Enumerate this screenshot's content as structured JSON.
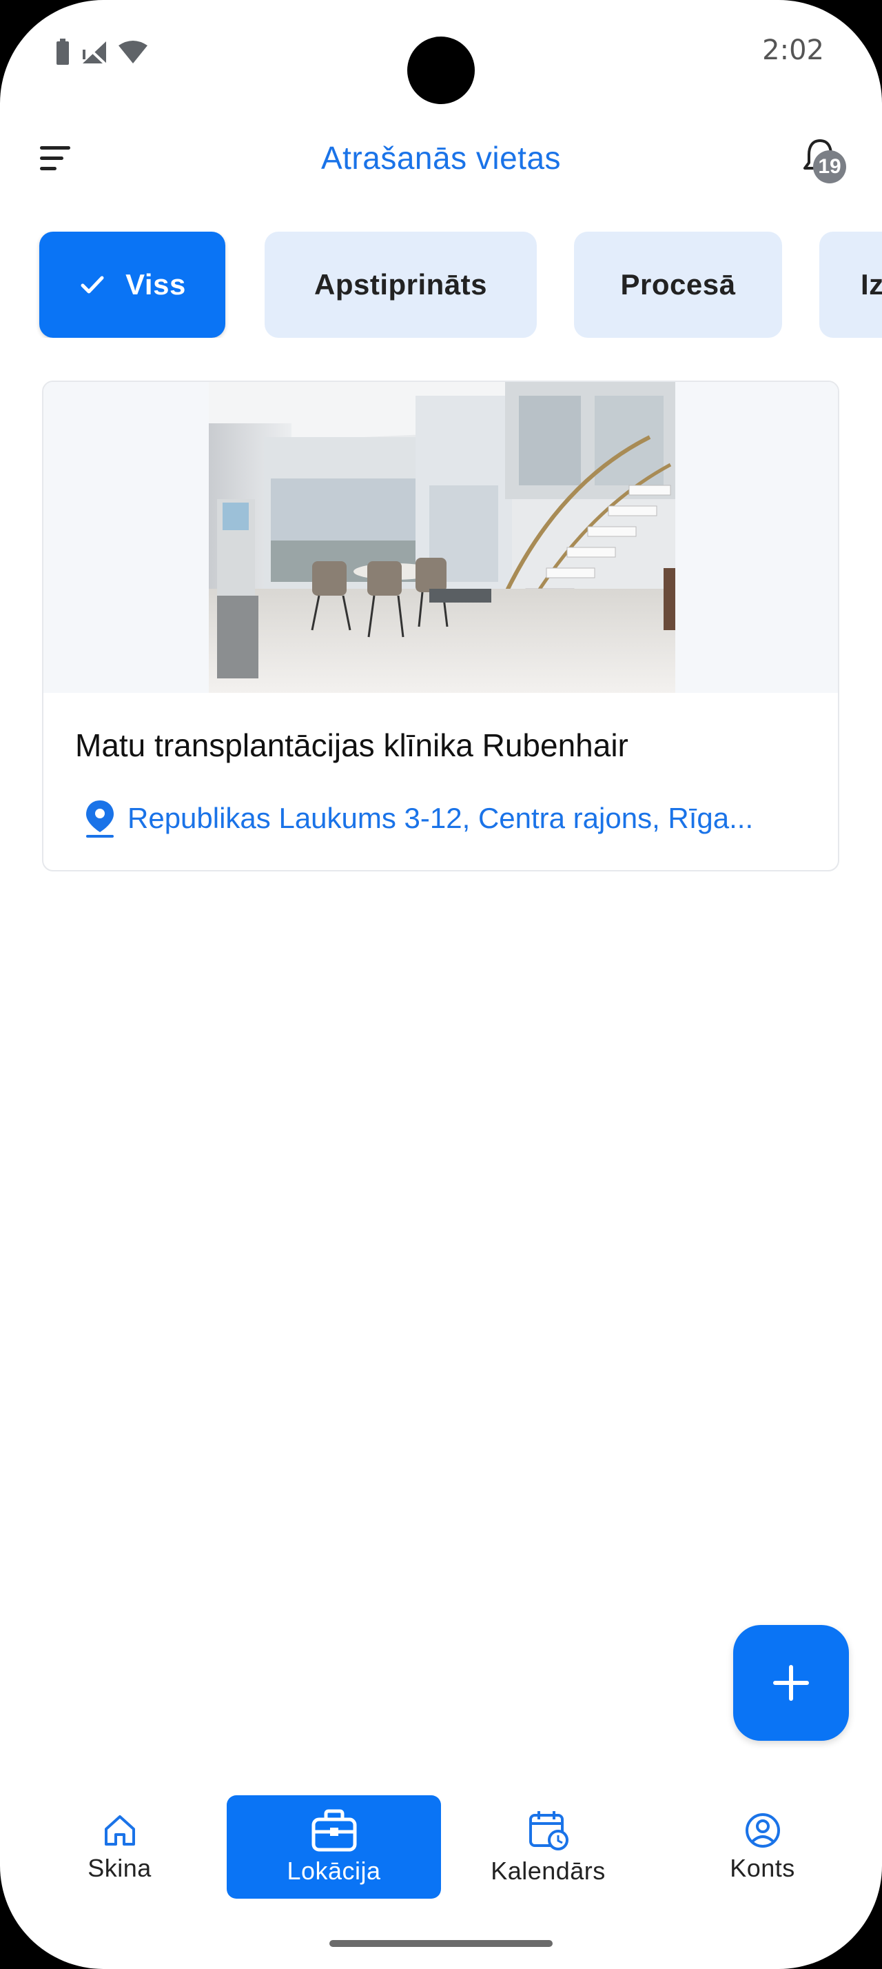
{
  "status_bar": {
    "time": "2:02"
  },
  "header": {
    "title": "Atrašanās vietas",
    "notification_count": "19"
  },
  "filters": [
    {
      "label": "Viss",
      "selected": true
    },
    {
      "label": "Apstiprināts",
      "selected": false
    },
    {
      "label": "Procesā",
      "selected": false
    },
    {
      "label": "Iz",
      "selected": false
    }
  ],
  "locations": [
    {
      "name": "Matu transplantācijas klīnika Rubenhair",
      "address": "Republikas Laukums 3-12, Centra rajons, Rīga..."
    }
  ],
  "fab": {
    "icon": "plus-icon"
  },
  "bottom_nav": [
    {
      "label": "Skina",
      "icon": "home-icon",
      "active": false
    },
    {
      "label": "Lokācija",
      "icon": "briefcase-icon",
      "active": true
    },
    {
      "label": "Kalendārs",
      "icon": "calendar-clock-icon",
      "active": false
    },
    {
      "label": "Konts",
      "icon": "account-icon",
      "active": false
    }
  ],
  "colors": {
    "accent": "#0a74f5",
    "title": "#1a73e8",
    "chip_bg": "#e3edfb"
  }
}
